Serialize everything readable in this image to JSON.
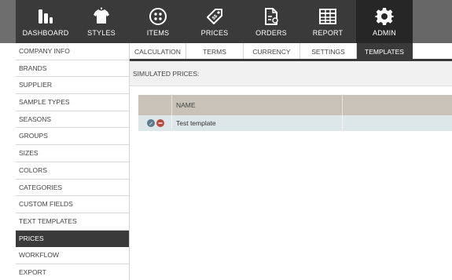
{
  "topnav": {
    "items": [
      {
        "label": "DASHBOARD",
        "icon": "dashboard-bars-icon"
      },
      {
        "label": "STYLES",
        "icon": "shirt-icon"
      },
      {
        "label": "ITEMS",
        "icon": "button-icon"
      },
      {
        "label": "PRICES",
        "icon": "price-tag-icon"
      },
      {
        "label": "ORDERS",
        "icon": "order-document-icon"
      },
      {
        "label": "REPORT",
        "icon": "table-grid-icon"
      },
      {
        "label": "ADMIN",
        "icon": "gear-icon"
      }
    ],
    "active": "ADMIN"
  },
  "sidebar": {
    "items": [
      {
        "label": "COMPANY INFO"
      },
      {
        "label": "BRANDS"
      },
      {
        "label": "SUPPLIER"
      },
      {
        "label": "SAMPLE TYPES"
      },
      {
        "label": "SEASONS"
      },
      {
        "label": "GROUPS"
      },
      {
        "label": "SIZES"
      },
      {
        "label": "COLORS"
      },
      {
        "label": "CATEGORIES"
      },
      {
        "label": "CUSTOM FIELDS"
      },
      {
        "label": "TEXT TEMPLATES"
      },
      {
        "label": "PRICES"
      },
      {
        "label": "WORKFLOW"
      },
      {
        "label": "EXPORT"
      }
    ],
    "active": "PRICES"
  },
  "tabs": {
    "items": [
      {
        "label": "CALCULATION"
      },
      {
        "label": "TERMS"
      },
      {
        "label": "CURRENCY"
      },
      {
        "label": "SETTINGS"
      },
      {
        "label": "TEMPLATES"
      }
    ],
    "active": "TEMPLATES"
  },
  "simulated": {
    "label": "SIMULATED PRICES:"
  },
  "table": {
    "columns": [
      "",
      "NAME",
      ""
    ],
    "rows": [
      {
        "name": "Test template",
        "actions": [
          "edit-icon",
          "delete-icon"
        ]
      }
    ]
  },
  "colors": {
    "nav_bg": "#3a3a3a",
    "nav_active": "#262626",
    "table_header": "#c9c2b8",
    "row_bg": "#dde6e8",
    "delete": "#b94a3f",
    "edit": "#5d7c8a"
  }
}
